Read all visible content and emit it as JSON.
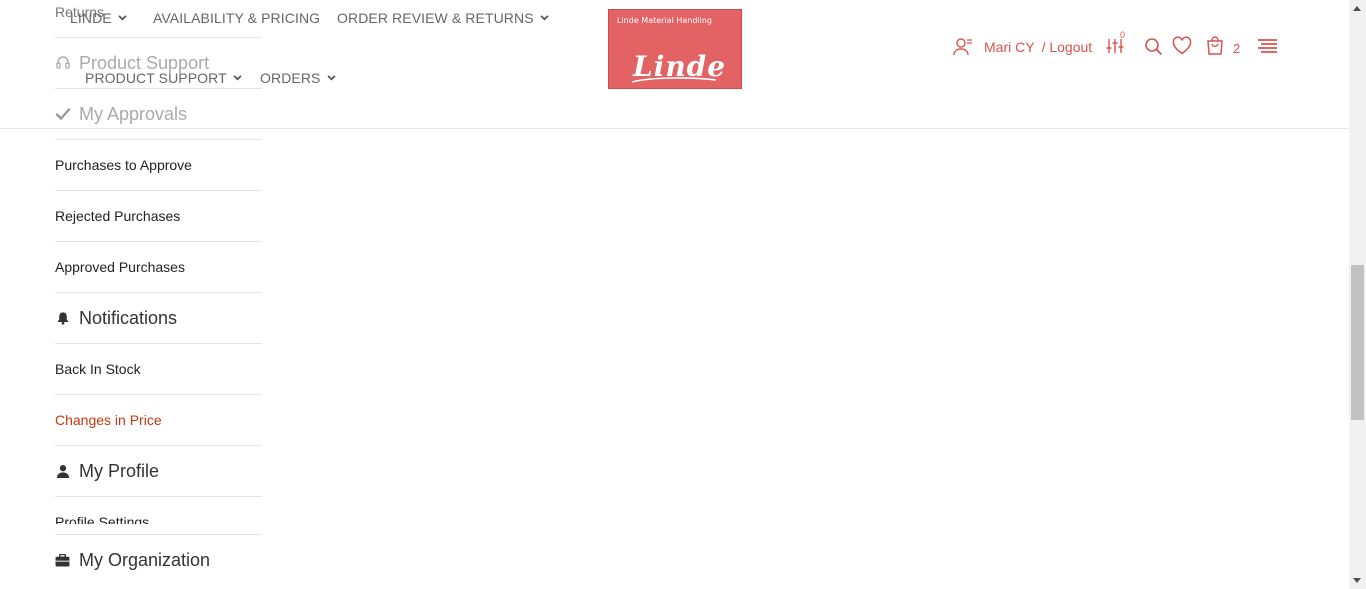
{
  "header": {
    "nav": [
      {
        "label": "LINDE"
      },
      {
        "label": "AVAILABILITY & PRICING"
      },
      {
        "label": "ORDER REVIEW & RETURNS"
      },
      {
        "label": "PRODUCT SUPPORT"
      },
      {
        "label": "ORDERS"
      }
    ],
    "logo": {
      "small_text": "Linde Material Handling",
      "big_text": "Linde",
      "background_color": "#e36264"
    },
    "user": {
      "name": "Mari CY",
      "logout_label": "/ Logout"
    },
    "compare_count": "0",
    "cart_count": "2",
    "icons": [
      "user-icon",
      "compare-icon",
      "search-icon",
      "wishlist-icon",
      "cart-icon",
      "menu-icon"
    ],
    "accent_color": "#d9534f"
  },
  "sidebar": {
    "items": [
      {
        "label": "Returns",
        "type": "link"
      },
      {
        "label": "Product Support",
        "type": "heading",
        "icon": "headset-icon"
      },
      {
        "label": "My Approvals",
        "type": "heading",
        "icon": "check-icon"
      },
      {
        "label": "Purchases to Approve",
        "type": "link"
      },
      {
        "label": "Rejected Purchases",
        "type": "link"
      },
      {
        "label": "Approved Purchases",
        "type": "link"
      },
      {
        "label": "Notifications",
        "type": "heading",
        "icon": "bell-icon"
      },
      {
        "label": "Back In Stock",
        "type": "link"
      },
      {
        "label": "Changes in Price",
        "type": "link",
        "active": true
      },
      {
        "label": "My Profile",
        "type": "heading",
        "icon": "person-icon"
      },
      {
        "label": "Profile Settings",
        "type": "link"
      }
    ],
    "bottom_heading": {
      "label": "My Organization",
      "icon": "briefcase-icon"
    },
    "active_color": "#c8370d"
  }
}
